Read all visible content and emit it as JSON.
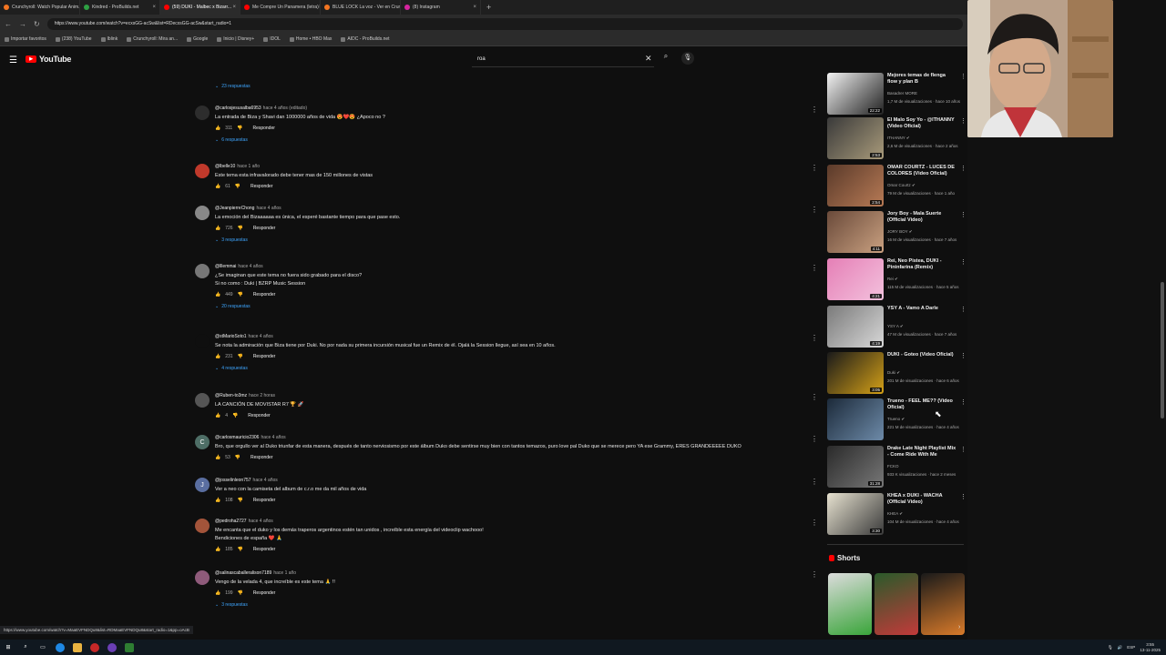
{
  "tabs": [
    {
      "title": "Crunchyroll: Watch Popular Anim..."
    },
    {
      "title": "Kindred - ProBuilds.net"
    },
    {
      "title": "(59) DUKI - Malbec x Bizarr..."
    },
    {
      "title": "Me Compre Un Panamera (letra)"
    },
    {
      "title": "BLUE LOCK La voz - Ver en Crunc..."
    },
    {
      "title": "(8) Instagram"
    }
  ],
  "browser": {
    "url": "https://www.youtube.com/watch?v=ecxsGG-acSw&list=RDecxsGG-acSw&start_radio=1",
    "new_tab": "+",
    "bookmarks": [
      "Importar favoritos",
      "(238) YouTube",
      "Iblink",
      "Crunchyroll: Mira an...",
      "Google",
      "Inicio | Disney+",
      "IDOL",
      "Home • HBO Max",
      "AIDC - ProBuilds.net"
    ]
  },
  "youtube": {
    "logo_text": "YouTube",
    "search_value": "roa"
  },
  "comments": {
    "top_replies": "23 respuestas",
    "reply_label": "Responder",
    "items": [
      {
        "user": "@carlosjesusalba6953",
        "time": "hace 4 años (editado)",
        "lines": [
          "La entrada de Biza y Shavi dan 1000000 años de vida 😍❤️😍 ¿Apoco no ?"
        ],
        "likes": "311",
        "replies": "6 respuestas",
        "avatar": "",
        "color": "#2d2d2d"
      },
      {
        "user": "@lbelle10",
        "time": "hace 1 año",
        "lines": [
          "Este tema esta infravalorado debe tener mas de 150 millones de vistas"
        ],
        "likes": "61",
        "replies": "",
        "avatar": "",
        "color": "#c0392b"
      },
      {
        "user": "@JeanpierreChong",
        "time": "hace 4 años",
        "lines": [
          "La emoción del Bizaaaaaa es única, el esperé bastante tiempo para que pase esto."
        ],
        "likes": "726",
        "replies": "3 respuestas",
        "avatar": "",
        "color": "#888"
      },
      {
        "user": "@lllemmai",
        "time": "hace 4 años",
        "lines": [
          "¿Se imaginan que este tema no fuera sido grabado para el disco?",
          "Si no como : Duki | BZRP Music Session"
        ],
        "likes": "449",
        "replies": "20 respuestas",
        "avatar": "",
        "color": "#777"
      },
      {
        "user": "@stMarioSoto1",
        "time": "hace 4 años",
        "lines": [
          "Se nota la admiración que Biza tiene por Duki. No por nada su primera incursión musical fue un Remix de él. Ojalá la Session llegue, así sea en 10 años."
        ],
        "likes": "231",
        "replies": "4 respuestas",
        "avatar": "",
        "color": "#0f0f0f"
      },
      {
        "user": "@Ruben-to3mz",
        "time": "hace 2 horas",
        "lines": [
          "LA CANCIÓN DE MOVISTAR R7 🏆 🚀"
        ],
        "likes": "4",
        "replies": "",
        "avatar": "",
        "color": "#555"
      },
      {
        "user": "@carlosmauricio2306",
        "time": "hace 4 años",
        "lines": [
          "Bro, que orgullo ver al Duko triunfar de esta manera, después de tanto nerviosismo por este álbum Duko debe sentirse muy bien con tantos temazos, puro love pal Duko que se merece pero YA ese Grammy, ERES GRANDEEEEE DUKO"
        ],
        "likes": "53",
        "replies": "",
        "avatar": "C",
        "color": "#4e6e66"
      },
      {
        "user": "@josselinleon757",
        "time": "hace 4 años",
        "lines": [
          "Ver a neo con la camiseta del album de c.r.o me da mil años de vida"
        ],
        "likes": "108",
        "replies": "",
        "avatar": "J",
        "color": "#5a6ea0"
      },
      {
        "user": "@pedroha2727",
        "time": "hace 4 años",
        "lines": [
          "Me encanta que el duko y los demás traperos argentinos estén tan unidos , increíble esta energía del videoclip wachooo!",
          "Bendiciones de españa ❤️ 🙏"
        ],
        "likes": "185",
        "replies": "",
        "avatar": "",
        "color": "#a3543a"
      },
      {
        "user": "@salinascaballeralison7189",
        "time": "hace 1 año",
        "lines": [
          "Vengo de la velada 4, que increíble es este tema 🙏 !!"
        ],
        "likes": "199",
        "replies": "3 respuestas",
        "avatar": "",
        "color": "#8e5a7a"
      }
    ]
  },
  "related": [
    {
      "title": "Mejores temas de flenga flow y plan B",
      "channel": "Basadrer MORE",
      "stats": "1,7 M de visualizaciones · hace 10 años",
      "duration": "22:22",
      "colors": [
        "#f2f2f2",
        "#222"
      ]
    },
    {
      "title": "El Malo Soy Yo - @ITHANNY (Video Oficial)",
      "channel": "ITHANNY ✔",
      "stats": "2,6 M de visualizaciones · hace 2 años",
      "duration": "2:53",
      "colors": [
        "#3a3a3a",
        "#a89a7a"
      ]
    },
    {
      "title": "OMAR COURTZ - LUCES DE COLORES (Video Oficial)",
      "channel": "Omar Courtz ✔",
      "stats": "79 M de visualizaciones · hace 1 año",
      "duration": "2:54",
      "colors": [
        "#5a3a2a",
        "#b77a55"
      ]
    },
    {
      "title": "Jory Boy - Mala Suerte (Official Video)",
      "channel": "JORY BOY ✔",
      "stats": "16 M de visualizaciones · hace 7 años",
      "duration": "4:11",
      "colors": [
        "#6a4a3a",
        "#c9a080"
      ]
    },
    {
      "title": "Rei, Neo Pistea, DUKI - Pininfarina (Remix)",
      "channel": "Rei ✔",
      "stats": "115 M de visualizaciones · hace 5 años",
      "duration": "4:21",
      "colors": [
        "#e57fb6",
        "#f3c1dd"
      ]
    },
    {
      "title": "YSY A - Vamo A Darle",
      "channel": "YSY A ✔",
      "stats": "47 M de visualizaciones · hace 7 años",
      "duration": "4:19",
      "colors": [
        "#7a7a7a",
        "#d8d8d8"
      ]
    },
    {
      "title": "DUKI - Goteo (Video Oficial)",
      "channel": "Duki ✔",
      "stats": "201 M de visualizaciones · hace 6 años",
      "duration": "3:05",
      "colors": [
        "#1a1a1a",
        "#d4a017"
      ]
    },
    {
      "title": "Trueno - FEEL ME?? (Video Oficial)",
      "channel": "Trueno ✔",
      "stats": "221 M de visualizaciones · hace 4 años",
      "duration": "",
      "colors": [
        "#1c2a3a",
        "#6d8aa8"
      ]
    },
    {
      "title": "Drake Late Night Playlist Mix - Come Ride With Me",
      "channel": "FCKO",
      "stats": "933 K visualizaciones · hace 2 meses",
      "duration": "31:28",
      "colors": [
        "#2a2a2a",
        "#777"
      ]
    },
    {
      "title": "KHEA x DUKI - WACHA (Official Video)",
      "channel": "KHEA ✔",
      "stats": "104 M de visualizaciones · hace 4 años",
      "duration": "3:30",
      "colors": [
        "#e7e2d0",
        "#3a3a3a"
      ]
    }
  ],
  "shorts": {
    "heading": "Shorts",
    "items": [
      {
        "colors": [
          "#dcdcdc",
          "#3aa53a"
        ]
      },
      {
        "colors": [
          "#2a5a2a",
          "#c23a3a"
        ]
      },
      {
        "colors": [
          "#1a1a1a",
          "#d87a2a"
        ]
      }
    ],
    "next": "›"
  },
  "status_url": "https://www.youtube.com/watch?v=MaaEVFNDQu8&list=RDMaaEVFNDQu8&start_radio=1&pp=oAcB",
  "taskbar": {
    "lang": "ESP",
    "time": "3:55",
    "date": "13-11-2025"
  }
}
